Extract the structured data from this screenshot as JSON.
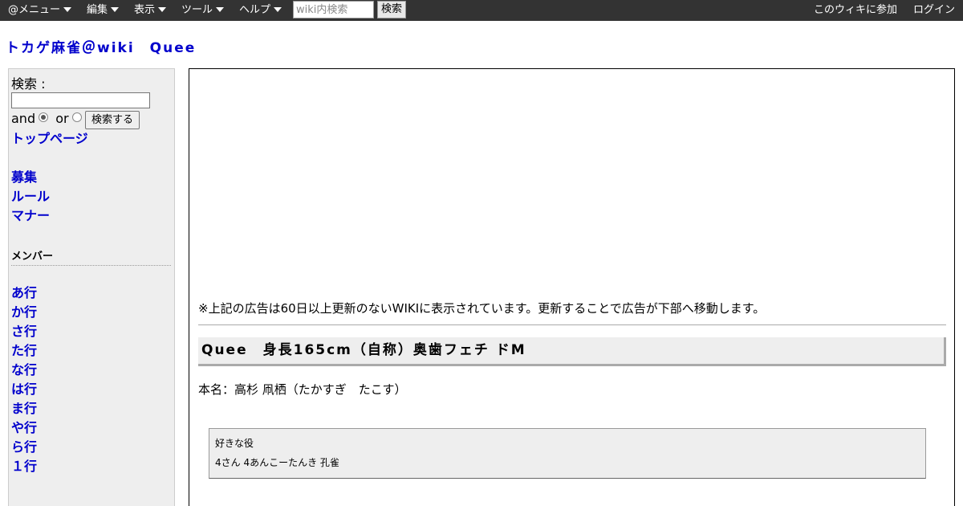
{
  "topbar": {
    "menus": [
      {
        "label": "@メニュー"
      },
      {
        "label": "編集"
      },
      {
        "label": "表示"
      },
      {
        "label": "ツール"
      },
      {
        "label": "ヘルプ"
      }
    ],
    "search_placeholder": "wiki内検索",
    "search_button": "検索",
    "join_link": "このウィキに参加",
    "login_link": "ログイン"
  },
  "site_title": "トカゲ麻雀＠wiki　Quee",
  "sidebar": {
    "search_label": "検索 :",
    "search_value": "",
    "mode_and": "and",
    "mode_or": "or",
    "selected_mode": "and",
    "search_button": "検索する",
    "links_top": [
      "トップページ",
      "募集",
      "ルール",
      "マナー"
    ],
    "members_heading": "メンバー",
    "member_links": [
      "あ行",
      "か行",
      "さ行",
      "た行",
      "な行",
      "は行",
      "ま行",
      "や行",
      "ら行",
      "１行"
    ]
  },
  "main": {
    "ad_notice": "※上記の広告は60日以上更新のないWIKIに表示されています。更新することで広告が下部へ移動します。",
    "heading": "Quee　身長165cm（自称）奥歯フェチ ドM",
    "real_name": "本名：高杉 凧栖（たかすぎ　たこす）",
    "favorite_label": "好きな役",
    "favorite_value": "4さん  4あんこーたんき  孔雀"
  },
  "colors": {
    "topbar_bg": "#333333",
    "link": "#0000cc",
    "sidebar_bg": "#eeeeee"
  }
}
